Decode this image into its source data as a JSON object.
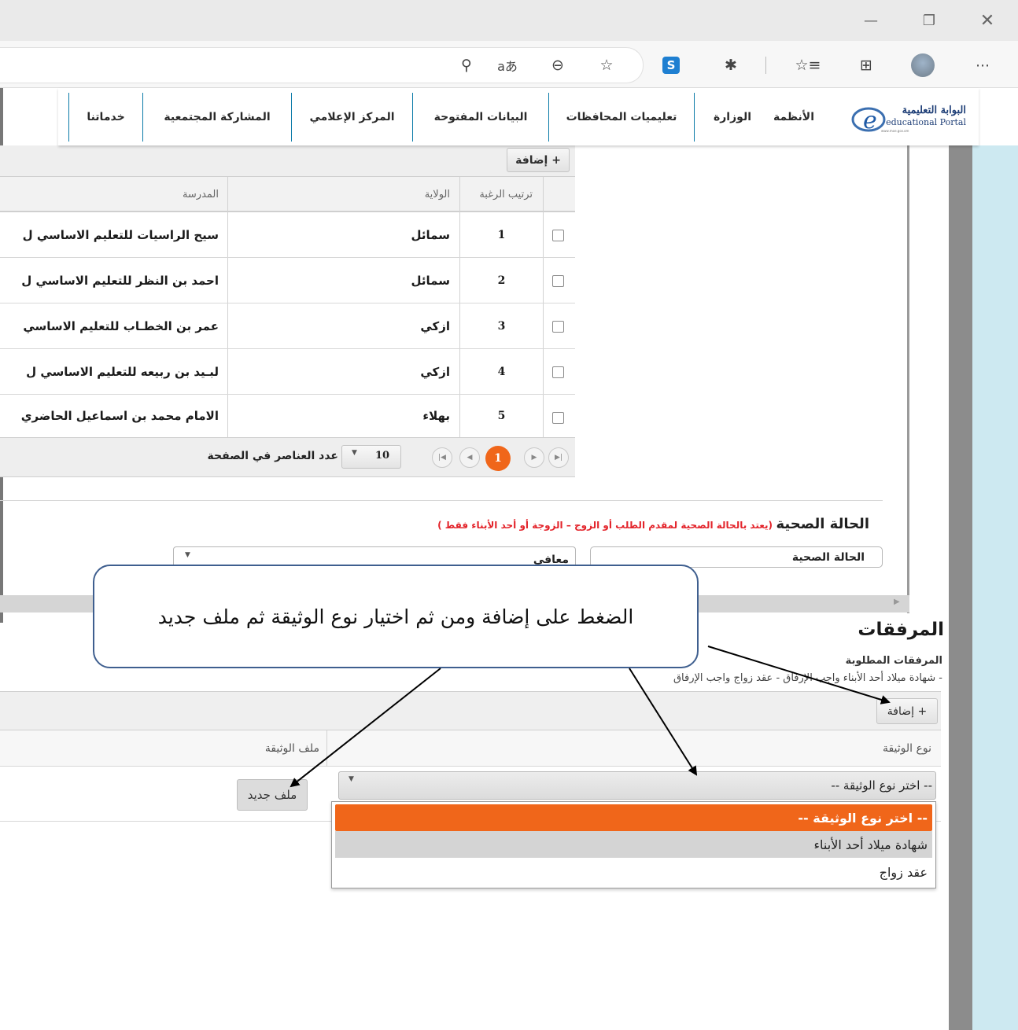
{
  "window": {
    "minimize_icon": "minimize-icon",
    "restore_icon": "restore-icon",
    "close_icon": "close-icon"
  },
  "browser_toolbar": {
    "icons": [
      "key-icon",
      "read-aloud-icon",
      "zoom-out-icon",
      "add-favorite-icon",
      "extension-s-icon",
      "extensions-puzzle-icon",
      "favorites-icon",
      "collections-icon",
      "profile-avatar-icon",
      "more-options-icon"
    ]
  },
  "site_nav": {
    "logo_ar": "البوابة التعليمية",
    "logo_en": "educational Portal",
    "logo_url_text": "www.moe.gov.om",
    "items": [
      {
        "label": "الأنظمة"
      },
      {
        "label": "الوزارة"
      },
      {
        "label": "تعليميات المحافظات"
      },
      {
        "label": "البيانات المفتوحة"
      },
      {
        "label": "المركز الإعلامي"
      },
      {
        "label": "المشاركة المجتمعية"
      },
      {
        "label": "خدماتنا"
      }
    ]
  },
  "schools_grid": {
    "add_label": "+ إضافة",
    "columns": {
      "order": "ترتيب الرغبة",
      "wilayat": "الولاية",
      "school": "المدرسة"
    },
    "rows": [
      {
        "order": "1",
        "wilayat": "سمائل",
        "school": "سيح الراسيات للتعليم الاساسي ل"
      },
      {
        "order": "2",
        "wilayat": "سمائل",
        "school": "احمد بن النظر للتعليم الاساسي ل"
      },
      {
        "order": "3",
        "wilayat": "ازكي",
        "school": "عمر بن الخطـاب للتعليم الاساسي"
      },
      {
        "order": "4",
        "wilayat": "ازكي",
        "school": "لبـيد بن ربيعه للتعليم الاساسي ل"
      },
      {
        "order": "5",
        "wilayat": "بهلاء",
        "school": "الامام محمد بن اسماعيل الحاضري"
      }
    ],
    "pager": {
      "current_page": "1",
      "page_size": "10",
      "page_size_label": "عدد العناصر في الصفحة"
    }
  },
  "health": {
    "title": "الحالة الصحية",
    "note": "(يعتد بالحالة الصحية لمقدم الطلب أو الزوج – الزوجة أو أحد الأبناء فقط )",
    "field_label": "الحالة الصحية",
    "value": "معافى"
  },
  "attachments": {
    "title": "المرفقات",
    "required_label": "المرفقات المطلوبة",
    "required_list": "- شهادة ميلاد أحد الأبناء واجب الإرفاق - عقد زواج واجب الإرفاق",
    "add_label": "+ إضافة",
    "columns": {
      "doc_type": "نوع الوثيقة",
      "doc_file": "ملف الوثيقة"
    },
    "selected_type": "-- اختر نوع الوثيقة --",
    "new_file_label": "ملف جديد",
    "options": [
      {
        "label": "-- اختر نوع الوثيقة --",
        "state": "selected"
      },
      {
        "label": "شهادة ميلاد أحد الأبناء",
        "state": "hover"
      },
      {
        "label": "عقد زواج",
        "state": "normal"
      }
    ]
  },
  "callout": {
    "text": "الضغط على إضافة ومن ثم اختيار نوع الوثيقة ثم ملف جديد"
  },
  "colors": {
    "accent_orange": "#f0661a",
    "nav_separator": "#0a7aa8",
    "note_red": "#e3242b",
    "callout_border": "#3f5f8f"
  }
}
